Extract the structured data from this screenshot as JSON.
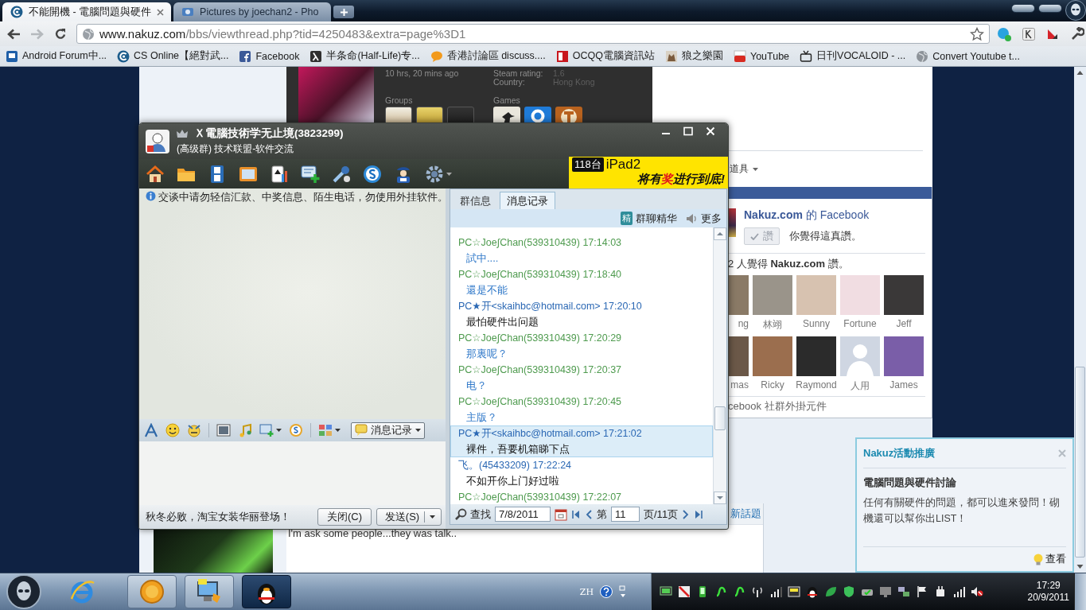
{
  "browser": {
    "tabs": [
      {
        "title": "不能開機 - 電腦問題與硬件",
        "selected": true
      },
      {
        "title": "Pictures by joechan2 - Pho",
        "selected": false
      }
    ],
    "address": {
      "domain": "www.nakuz.com",
      "path": "/bbs/viewthread.php?tid=4250483&extra=page%3D1"
    },
    "bookmarks": [
      {
        "label": "Android Forum中..."
      },
      {
        "label": "CS Online【絕對武..."
      },
      {
        "label": "Facebook"
      },
      {
        "label": "半条命(Half-Life)专..."
      },
      {
        "label": "香港討論區 discuss...."
      },
      {
        "label": "OCQQ電腦資訊站"
      },
      {
        "label": "狼之樂園"
      },
      {
        "label": "YouTube"
      },
      {
        "label": "日刊VOCALOID - ..."
      },
      {
        "label": "Convert Youtube t..."
      }
    ]
  },
  "page": {
    "steam_card": {
      "last_online": "10 hrs, 20 mins ago",
      "rating_label": "Steam rating:",
      "rating": "1.6",
      "country_label": "Country:",
      "country": "Hong Kong",
      "groups_label": "Groups",
      "games_label": "Games"
    },
    "tools_menu": "道具",
    "facebook": {
      "title": "**Nakuz.com** 的 Facebook",
      "like_button": "讚",
      "liked": true,
      "like_note": "你覺得這真讚。",
      "fan_count": "2 人覺得 **Nakuz.com** 讚。",
      "fans": [
        {
          "name": "ng",
          "kind": "photo"
        },
        {
          "name": "林翊",
          "kind": "photo"
        },
        {
          "name": "Sunny",
          "kind": "photo"
        },
        {
          "name": "Fortune",
          "kind": "photo"
        },
        {
          "name": "Jeff",
          "kind": "photo"
        },
        {
          "name": "mas",
          "kind": "photo"
        },
        {
          "name": "Ricky",
          "kind": "photo"
        },
        {
          "name": "Raymond",
          "kind": "photo"
        },
        {
          "name": "人用",
          "kind": "default"
        },
        {
          "name": "James",
          "kind": "photo"
        }
      ],
      "footer": "cebook 社群外掛元件"
    },
    "new_topic": "新話題",
    "post_text": "I'm ask some people...they was talk.."
  },
  "qq": {
    "title": "Ｘ電腦技術学无止境(3823299)",
    "subtitle": "(高级群) 技术联盟-软件交流",
    "banner": {
      "count": "118台",
      "product": "iPad2",
      "slogan_start": "将有",
      "slogan_prize": "奖",
      "slogan_end": "进行到底!"
    },
    "notice": "交谈中请勿轻信汇款、中奖信息、陌生电话，勿使用外挂软件。",
    "history_button": "消息记录",
    "ad_text": "秋冬必败，淘宝女装华丽登场！",
    "close_button": "关闭(C)",
    "send_button": "发送(S)",
    "tabs": [
      {
        "label": "群信息",
        "selected": false
      },
      {
        "label": "消息记录",
        "selected": true
      }
    ],
    "essence_badge": "精",
    "essence_label": "群聊精华",
    "more_label": "更多",
    "messages": [
      {
        "sender": "PC☆Joe∫Chan(539310439) 17:14:03",
        "text": "試中....",
        "kind": "self",
        "selected": false
      },
      {
        "sender": "PC☆Joe∫Chan(539310439) 17:18:40",
        "text": "還是不能",
        "kind": "self",
        "selected": false
      },
      {
        "sender": "PC★开<skaihbc@hotmail.com> 17:20:10",
        "text": "最怕硬件出问题",
        "kind": "other",
        "selected": false
      },
      {
        "sender": "PC☆Joe∫Chan(539310439) 17:20:29",
        "text": "那裏呢？",
        "kind": "self",
        "selected": false
      },
      {
        "sender": "PC☆Joe∫Chan(539310439) 17:20:37",
        "text": "电？",
        "kind": "self",
        "selected": false
      },
      {
        "sender": "PC☆Joe∫Chan(539310439) 17:20:45",
        "text": "主版？",
        "kind": "self",
        "selected": false
      },
      {
        "sender": "PC★开<skaihbc@hotmail.com> 17:21:02",
        "text": "裸件，吾要机箱睇下点",
        "kind": "other",
        "selected": true
      },
      {
        "sender": "飞。(45433209) 17:22:24",
        "text": "不如开你上门好过啦",
        "kind": "other",
        "selected": false
      },
      {
        "sender": "PC☆Joe∫Chan(539310439) 17:22:07",
        "kind": "self",
        "selected": false
      }
    ],
    "search": {
      "label": "查找",
      "date": "7/8/2011",
      "page_prefix": "第",
      "page": "11",
      "page_suffix": "页/11页"
    }
  },
  "popup": {
    "title": "Nakuz活動推廣",
    "heading": "電腦問題與硬件討論",
    "body": "任何有關硬件的問題，都可以進來發問！砌機還可以幫你出LIST！",
    "action": "查看"
  },
  "taskbar": {
    "apps": [
      {
        "running": false,
        "selected": false
      },
      {
        "running": true,
        "selected": false
      },
      {
        "running": true,
        "selected": false
      },
      {
        "running": true,
        "selected": true
      }
    ],
    "language": "ZH",
    "time": "17:29",
    "date": "20/9/2011"
  }
}
